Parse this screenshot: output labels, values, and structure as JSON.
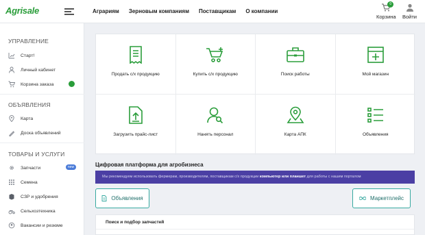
{
  "header": {
    "logo": "Agrisale",
    "nav": [
      "Аграриям",
      "Зерновым компаниям",
      "Поставщикам",
      "О компании"
    ],
    "cart_label": "Корзина",
    "cart_count": "0",
    "login_label": "Войти"
  },
  "sidebar": {
    "sections": [
      {
        "title": "УПРАВЛЕНИЕ",
        "items": [
          {
            "label": "Старт!",
            "icon": "chart-icon"
          },
          {
            "label": "Личный кабинет",
            "icon": "user-icon"
          },
          {
            "label": "Корзина заказа",
            "icon": "cart-icon",
            "badge": ""
          }
        ]
      },
      {
        "title": "ОБЪЯВЛЕНИЯ",
        "items": [
          {
            "label": "Карта",
            "icon": "map-icon"
          },
          {
            "label": "Доска объявлений",
            "icon": "board-icon"
          }
        ]
      },
      {
        "title": "ТОВАРЫ И УСЛУГИ",
        "items": [
          {
            "label": "Запчасти",
            "icon": "gear-icon",
            "pill": "new"
          },
          {
            "label": "Семена",
            "icon": "seeds-icon"
          },
          {
            "label": "СЗР и удобрения",
            "icon": "fertilizer-icon"
          },
          {
            "label": "Сельхозтехника",
            "icon": "tractor-icon"
          },
          {
            "label": "Вакансии и резюме",
            "icon": "jobs-icon"
          }
        ]
      }
    ]
  },
  "tiles": [
    {
      "label": "Продать с/х продукцию",
      "icon": "receipt-icon"
    },
    {
      "label": "Купить с/х продукцию",
      "icon": "cart-add-icon"
    },
    {
      "label": "Поиск работы",
      "icon": "briefcase-icon"
    },
    {
      "label": "Мой магазин",
      "icon": "store-icon"
    },
    {
      "label": "Загрузить прайс-лист",
      "icon": "upload-icon"
    },
    {
      "label": "Нанять персонал",
      "icon": "hire-icon"
    },
    {
      "label": "Карта АПК",
      "icon": "map-pin-icon"
    },
    {
      "label": "Объявления",
      "icon": "list-icon"
    }
  ],
  "platform_title": "Цифровая платформа для агробизнеса",
  "banner": {
    "text_before": "Мы рекомендуем использовать фермерам, производителям, поставщикам с/х продукции ",
    "bold": "компьютер или планшет",
    "text_after": " для работы с нашим порталом"
  },
  "buttons": {
    "ads": "Объявления",
    "market": "Маркетплейс"
  },
  "search_section": {
    "title": "Поиск и подбор запчастей"
  },
  "colors": {
    "accent": "#2a9d3a",
    "banner": "#4b3fa4",
    "button_border": "#36a9a0"
  }
}
